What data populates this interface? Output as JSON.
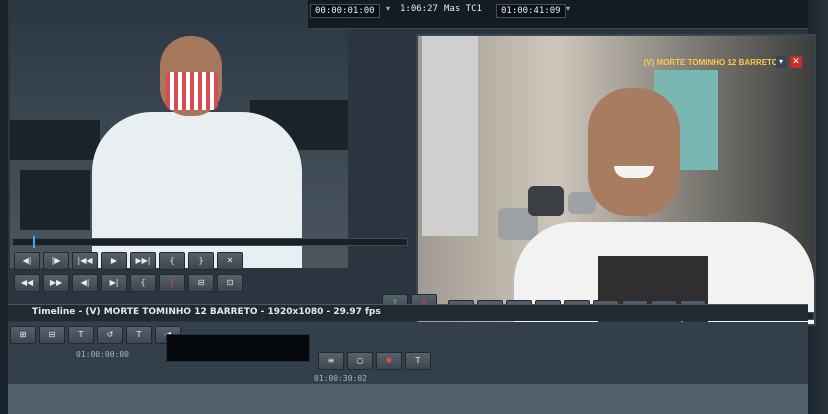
{
  "header": {
    "timecode_in": "00:00:01:00",
    "duration": "1:06:27",
    "track_label": "Mas TC1",
    "timecode_current": "01:00:41:09"
  },
  "record_monitor": {
    "sequence_name": "(V) MORTE TOMINHO 12 BARRETO"
  },
  "timeline": {
    "title": "Timeline - (V) MORTE TOMINHO 12 BARRETO - 1920x1080 - 29.97 fps",
    "tc_start": "01:00:00:00",
    "tc_mark": "01:00:30:02"
  },
  "controls": {
    "source_row1": [
      "◀|",
      "|▶",
      "|◀◀",
      "▶",
      "▶▶|",
      "{",
      "}",
      "✕"
    ],
    "source_row2": [
      "◀◀",
      "▶▶",
      "◀|",
      "▶|",
      "{",
      "}",
      "⊟",
      "⊡"
    ],
    "record_row1": [
      "◀|",
      "|▶",
      "{",
      "}",
      "▶",
      "{",
      "}",
      "✕",
      "⊟"
    ],
    "record_row2": [
      "◀◀",
      "▶▶",
      "◀|",
      "▶|",
      "|▶",
      "▶",
      "⊡",
      "⊘",
      "▲"
    ],
    "tool_icons": [
      "⊞",
      "⊟",
      "T",
      "↺",
      "T",
      "◀"
    ]
  },
  "colors": {
    "accent": "#4aa3ff",
    "sequence_text": "#ffc94a",
    "mark_red": "#ff4141"
  }
}
